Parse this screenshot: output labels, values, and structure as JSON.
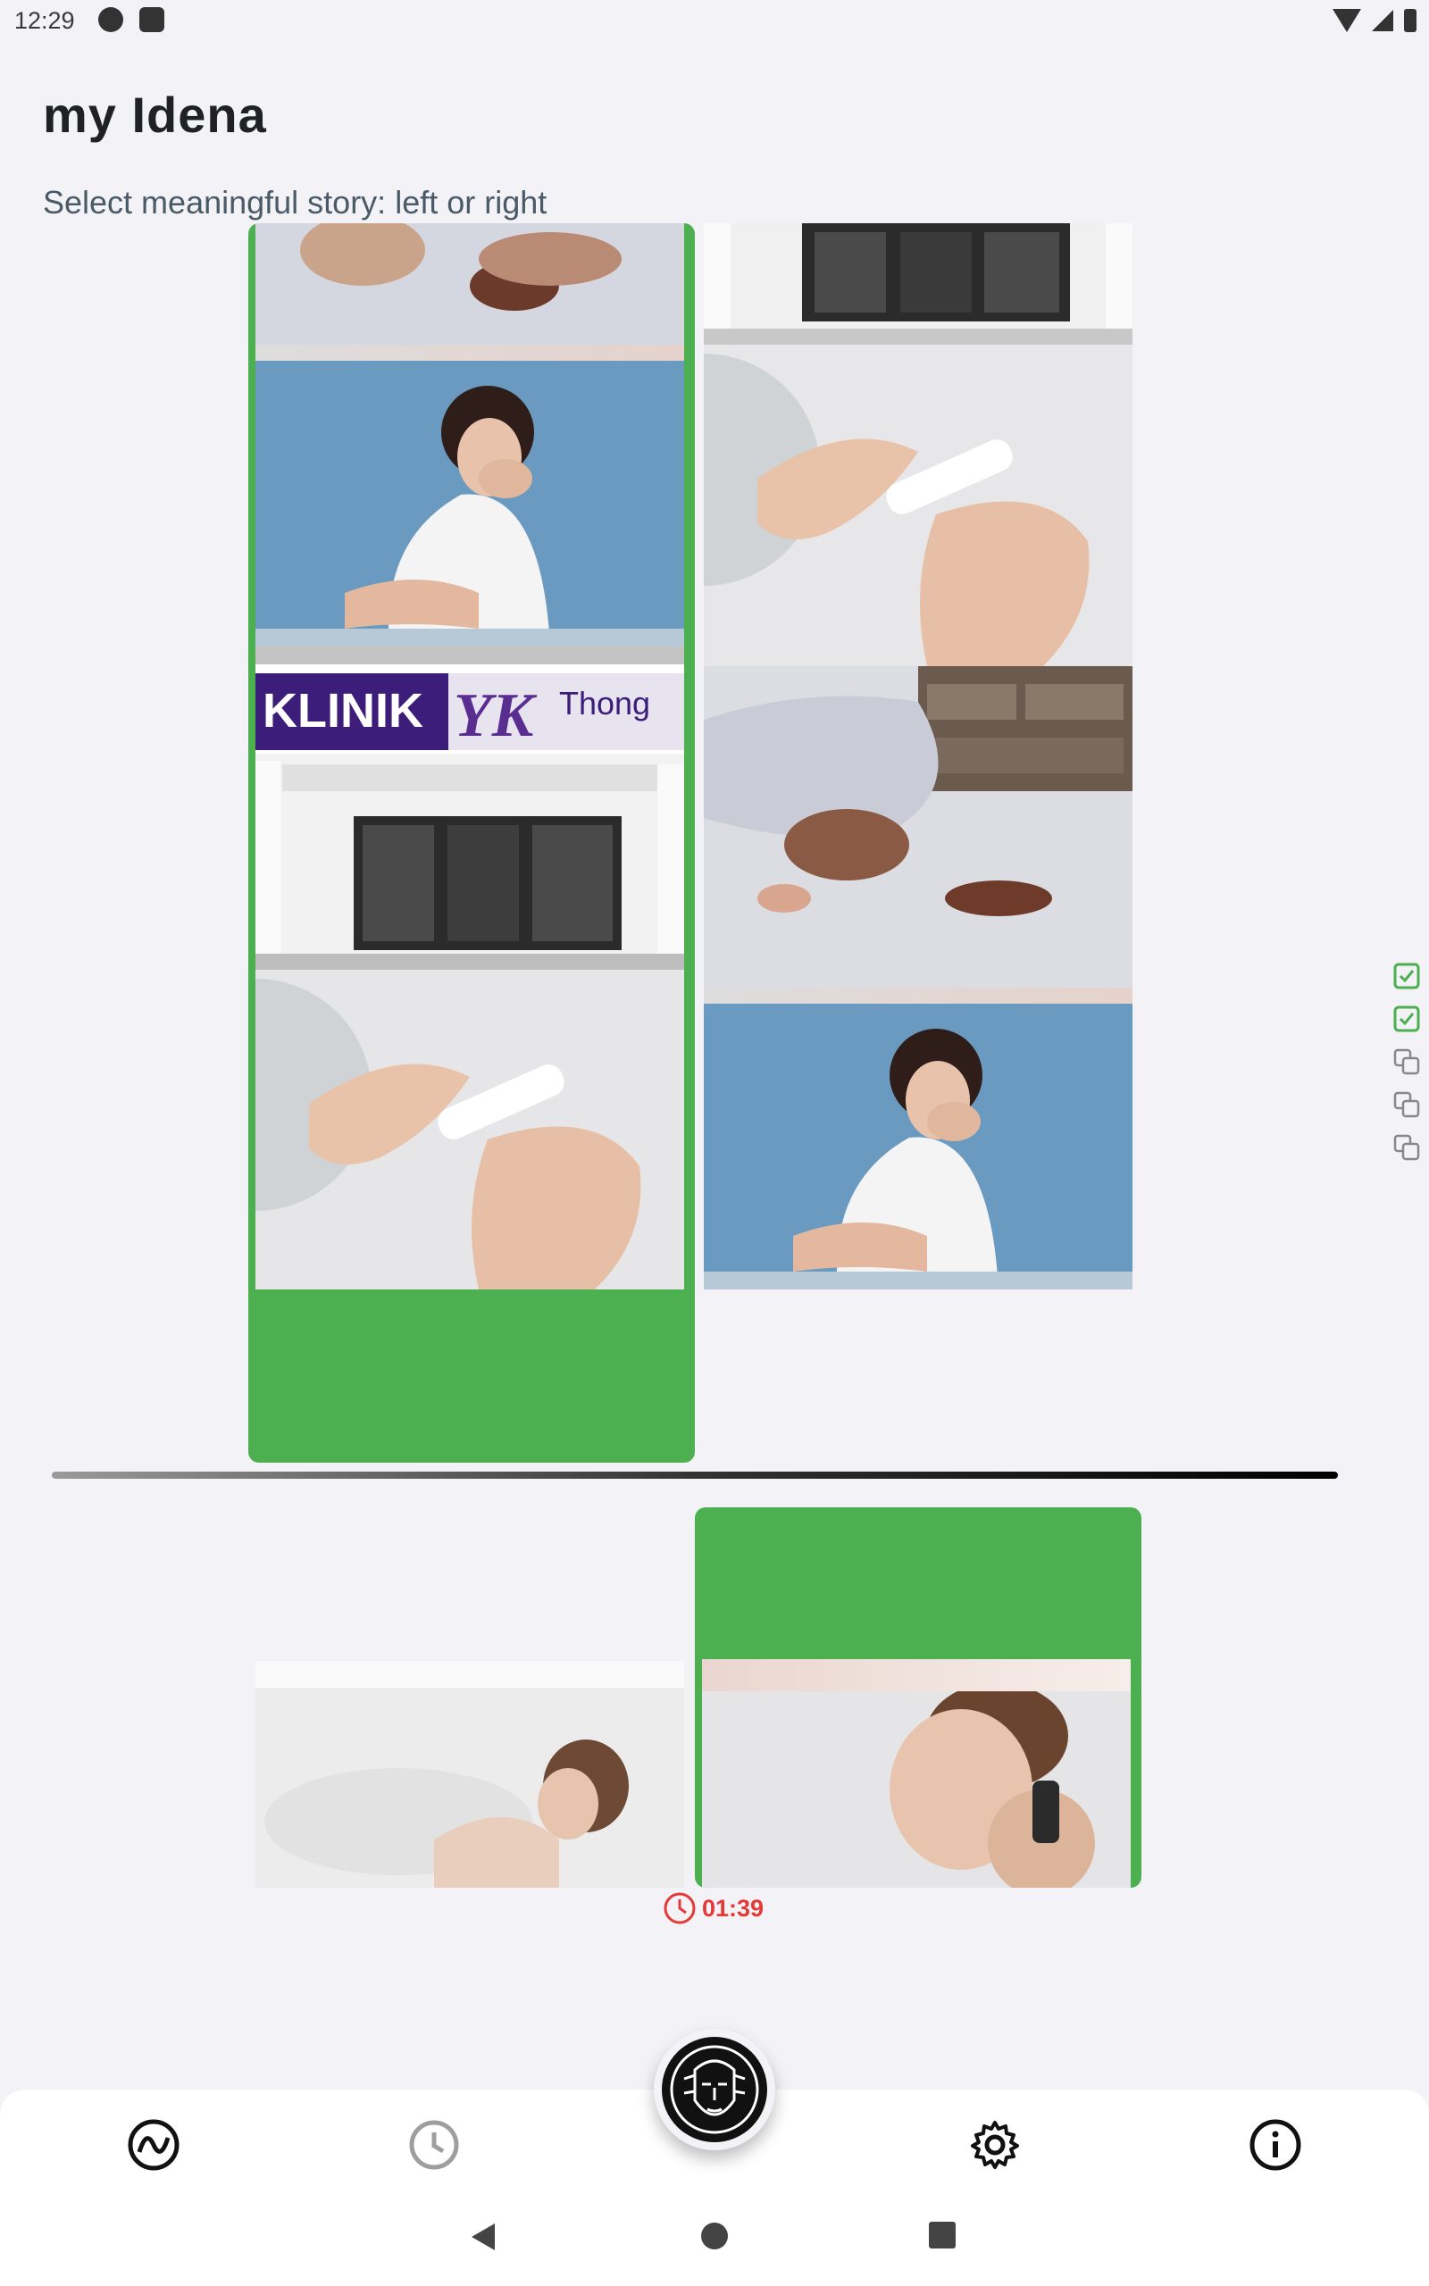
{
  "status_bar": {
    "time": "12:29"
  },
  "app": {
    "title": "my Idena"
  },
  "instructions": {
    "prompt": "Select meaningful story: left or right"
  },
  "top_story_left": {
    "selected": true,
    "frames": [
      {
        "icon": "person-on-bed-image"
      },
      {
        "icon": "woman-nausea-image"
      },
      {
        "icon": "clinic-storefront-image",
        "sign_main": "KLINIK",
        "sign_logo": "YK",
        "sign_name": "Thong"
      },
      {
        "icon": "pregnancy-test-image"
      }
    ]
  },
  "top_story_right": {
    "selected": false,
    "frames": [
      {
        "icon": "clinic-entrance-image"
      },
      {
        "icon": "pregnancy-test-image"
      },
      {
        "icon": "person-on-bed-image"
      },
      {
        "icon": "woman-nausea-image"
      }
    ]
  },
  "bottom_story_left": {
    "selected": false,
    "frames": [
      {
        "icon": "woman-bath-image"
      }
    ]
  },
  "bottom_story_right": {
    "selected": true,
    "frames": [
      {
        "icon": "woman-phone-image"
      }
    ]
  },
  "progress_indicators": [
    {
      "icon": "checkbox-checked-icon",
      "state": "done"
    },
    {
      "icon": "checkbox-checked-icon",
      "state": "done"
    },
    {
      "icon": "copy-icon",
      "state": "pending"
    },
    {
      "icon": "copy-icon",
      "state": "pending"
    },
    {
      "icon": "copy-icon",
      "state": "pending"
    }
  ],
  "timer": {
    "value": "01:39"
  },
  "bottom_nav": [
    {
      "icon": "idena-coin-icon",
      "active": true
    },
    {
      "icon": "history-clock-icon",
      "active": false
    },
    {
      "icon": "idena-avatar-icon",
      "active": true
    },
    {
      "icon": "settings-gear-icon",
      "active": false
    },
    {
      "icon": "info-icon",
      "active": false
    }
  ],
  "colors": {
    "accent": "#4caf50",
    "timer": "#e53935",
    "background": "#f2f2f7"
  }
}
